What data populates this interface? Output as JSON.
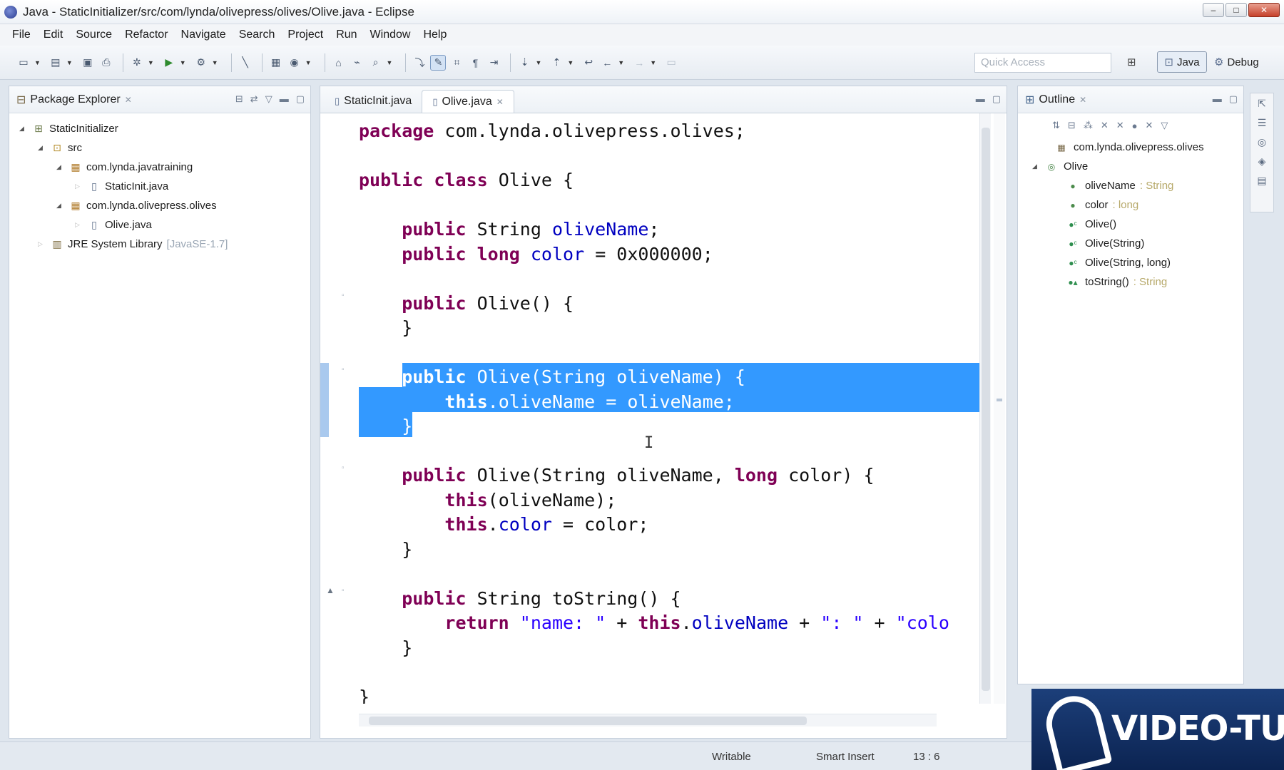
{
  "window": {
    "title": "Java - StaticInitializer/src/com/lynda/olivepress/olives/Olive.java - Eclipse",
    "controls": [
      "–",
      "□",
      "✕"
    ]
  },
  "menu": [
    "File",
    "Edit",
    "Source",
    "Refactor",
    "Navigate",
    "Search",
    "Project",
    "Run",
    "Window",
    "Help"
  ],
  "toolbar": {
    "quick_access_placeholder": "Quick Access",
    "perspectives": {
      "java": "Java",
      "debug": "Debug"
    }
  },
  "package_explorer": {
    "title": "Package Explorer",
    "tree": [
      {
        "label": "StaticInitializer",
        "decoration": ""
      },
      {
        "label": "src",
        "decoration": ""
      },
      {
        "label": "com.lynda.javatraining",
        "decoration": ""
      },
      {
        "label": "StaticInit.java",
        "decoration": ""
      },
      {
        "label": "com.lynda.olivepress.olives",
        "decoration": ""
      },
      {
        "label": "Olive.java",
        "decoration": ""
      },
      {
        "label": "JRE System Library",
        "decoration": "[JavaSE-1.7]"
      }
    ]
  },
  "editor": {
    "tabs": [
      {
        "label": "StaticInit.java",
        "active": false
      },
      {
        "label": "Olive.java",
        "active": true
      }
    ],
    "code": [
      [
        [
          "kw",
          "package"
        ],
        [
          "t",
          " com.lynda.olivepress.olives;"
        ]
      ],
      [
        [
          "t",
          ""
        ]
      ],
      [
        [
          "kw",
          "public"
        ],
        [
          "t",
          " "
        ],
        [
          "kw",
          "class"
        ],
        [
          "t",
          " Olive {"
        ]
      ],
      [
        [
          "t",
          ""
        ]
      ],
      [
        [
          "t",
          "    "
        ],
        [
          "kw",
          "public"
        ],
        [
          "t",
          " String "
        ],
        [
          "fld",
          "oliveName"
        ],
        [
          "t",
          ";"
        ]
      ],
      [
        [
          "t",
          "    "
        ],
        [
          "kw",
          "public"
        ],
        [
          "t",
          " "
        ],
        [
          "kw",
          "long"
        ],
        [
          "t",
          " "
        ],
        [
          "fld",
          "color"
        ],
        [
          "t",
          " = 0x000000;"
        ]
      ],
      [
        [
          "t",
          ""
        ]
      ],
      [
        [
          "t",
          "    "
        ],
        [
          "kw",
          "public"
        ],
        [
          "t",
          " Olive() {"
        ]
      ],
      [
        [
          "t",
          "    }"
        ]
      ],
      [
        [
          "t",
          ""
        ]
      ],
      [
        [
          "t",
          "    "
        ],
        [
          "kw",
          "public"
        ],
        [
          "t",
          " Olive(String oliveName) {"
        ]
      ],
      [
        [
          "t",
          "        "
        ],
        [
          "kw",
          "this"
        ],
        [
          "t",
          "."
        ],
        [
          "fld",
          "oliveName"
        ],
        [
          "t",
          " = oliveName;"
        ]
      ],
      [
        [
          "t",
          "    }"
        ]
      ],
      [
        [
          "t",
          ""
        ]
      ],
      [
        [
          "t",
          "    "
        ],
        [
          "kw",
          "public"
        ],
        [
          "t",
          " Olive(String oliveName, "
        ],
        [
          "kw",
          "long"
        ],
        [
          "t",
          " color) {"
        ]
      ],
      [
        [
          "t",
          "        "
        ],
        [
          "kw",
          "this"
        ],
        [
          "t",
          "(oliveName);"
        ]
      ],
      [
        [
          "t",
          "        "
        ],
        [
          "kw",
          "this"
        ],
        [
          "t",
          "."
        ],
        [
          "fld",
          "color"
        ],
        [
          "t",
          " = color;"
        ]
      ],
      [
        [
          "t",
          "    }"
        ]
      ],
      [
        [
          "t",
          ""
        ]
      ],
      [
        [
          "t",
          "    "
        ],
        [
          "kw",
          "public"
        ],
        [
          "t",
          " String toString() {"
        ]
      ],
      [
        [
          "t",
          "        "
        ],
        [
          "kw",
          "return"
        ],
        [
          "t",
          " "
        ],
        [
          "str",
          "\"name: \""
        ],
        [
          "t",
          " + "
        ],
        [
          "kw",
          "this"
        ],
        [
          "t",
          "."
        ],
        [
          "fld",
          "oliveName"
        ],
        [
          "t",
          " + "
        ],
        [
          "str",
          "\": \""
        ],
        [
          "t",
          " + "
        ],
        [
          "str",
          "\"colo"
        ]
      ],
      [
        [
          "t",
          "    }"
        ]
      ],
      [
        [
          "t",
          ""
        ]
      ],
      [
        [
          "t",
          "}"
        ]
      ]
    ]
  },
  "outline": {
    "title": "Outline",
    "items": [
      {
        "label": "com.lynda.olivepress.olives",
        "type": "",
        "icon": "package-icon"
      },
      {
        "label": "Olive",
        "type": "",
        "icon": "class-icon"
      },
      {
        "label": "oliveName",
        "type": ": String",
        "icon": "field-icon"
      },
      {
        "label": "color",
        "type": ": long",
        "icon": "field-icon"
      },
      {
        "label": "Olive()",
        "type": "",
        "icon": "constructor-icon"
      },
      {
        "label": "Olive(String)",
        "type": "",
        "icon": "constructor-icon"
      },
      {
        "label": "Olive(String, long)",
        "type": "",
        "icon": "constructor-icon"
      },
      {
        "label": "toString()",
        "type": ": String",
        "icon": "method-icon"
      }
    ]
  },
  "status": {
    "writable": "Writable",
    "insert_mode": "Smart Insert",
    "position": "13 : 6"
  },
  "watermark": {
    "text": "VIDEO-TUTOR"
  }
}
